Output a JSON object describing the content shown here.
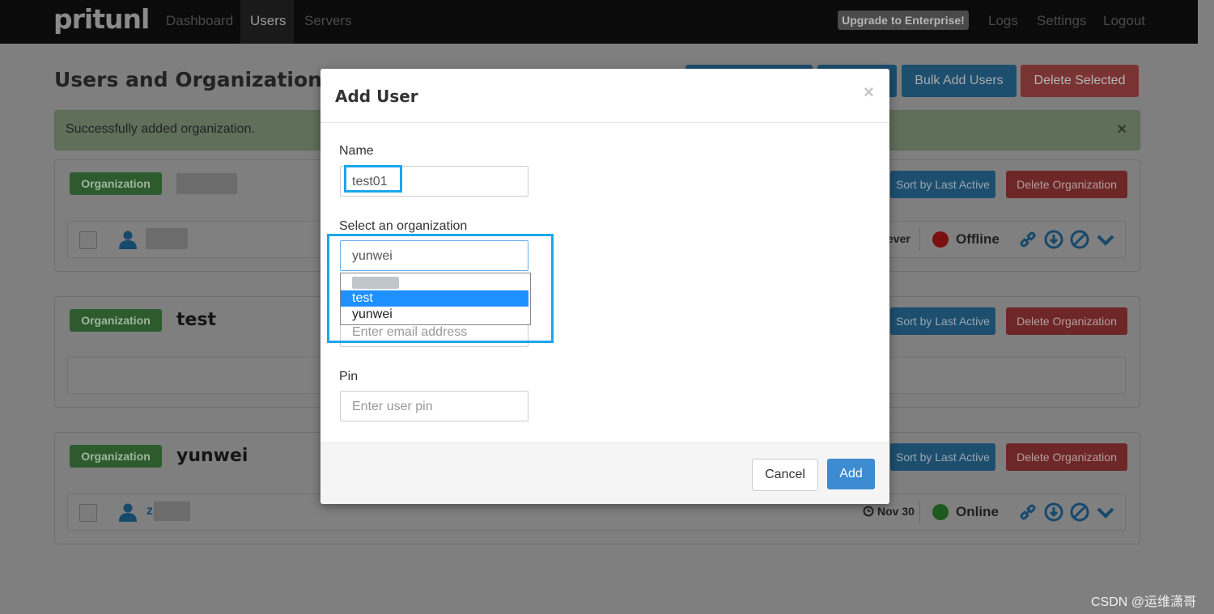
{
  "navbar": {
    "logo": "pritunl",
    "links": [
      "Dashboard",
      "Users",
      "Servers"
    ],
    "active": "Users",
    "upgrade_label": "Upgrade to Enterprise!",
    "right_links": [
      "Logs",
      "Settings",
      "Logout"
    ]
  },
  "page": {
    "title": "Users and Organizations",
    "buttons": {
      "bulk_add": "Bulk Add Users",
      "delete_selected": "Delete Selected"
    },
    "alert": {
      "text": "Successfully added organization.",
      "close": "×"
    }
  },
  "organizations": [
    {
      "badge": "Organization",
      "name": "",
      "sort_label": "Sort by Last Active",
      "delete_label": "Delete Organization",
      "user": {
        "last_active": "ever",
        "status": "Offline",
        "status_color": "#7a1010"
      }
    },
    {
      "badge": "Organization",
      "name": "test",
      "sort_label": "Sort by Last Active",
      "delete_label": "Delete Organization"
    },
    {
      "badge": "Organization",
      "name": "yunwei",
      "sort_label": "Sort by Last Active",
      "delete_label": "Delete Organization",
      "user": {
        "name_initial": "z",
        "last_active": "Nov 30",
        "status": "Online",
        "status_color": "#1d5a1d"
      }
    }
  ],
  "modal": {
    "title": "Add User",
    "close": "×",
    "name_label": "Name",
    "name_value": "test01",
    "org_label": "Select an organization",
    "org_selected": "yunwei",
    "org_options": [
      "",
      "test",
      "yunwei"
    ],
    "org_highlighted": "test",
    "email_placeholder": "Enter email address",
    "pin_label": "Pin",
    "pin_placeholder": "Enter user pin",
    "cancel_label": "Cancel",
    "add_label": "Add"
  },
  "watermark": "CSDN @运维潇哥",
  "colors": {
    "highlight": "#1aa7ec",
    "primary": "#3d8bd0",
    "selected": "#1e90ff"
  }
}
